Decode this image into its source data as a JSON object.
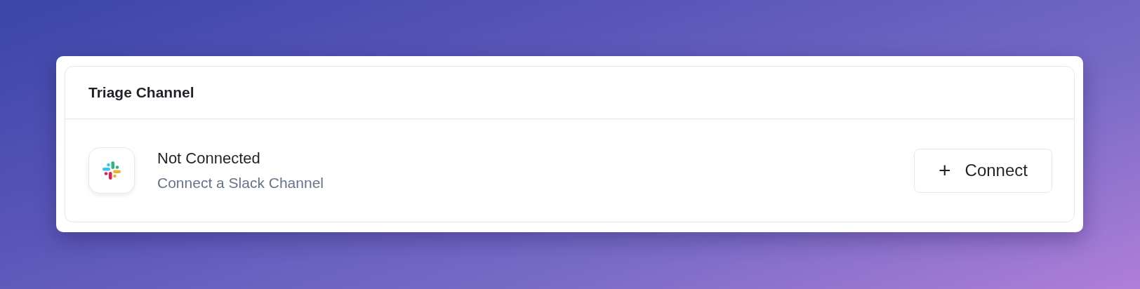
{
  "card": {
    "title": "Triage Channel",
    "integration": {
      "status": "Not Connected",
      "description": "Connect a Slack Channel"
    },
    "action": {
      "icon": "+",
      "label": "Connect"
    }
  }
}
